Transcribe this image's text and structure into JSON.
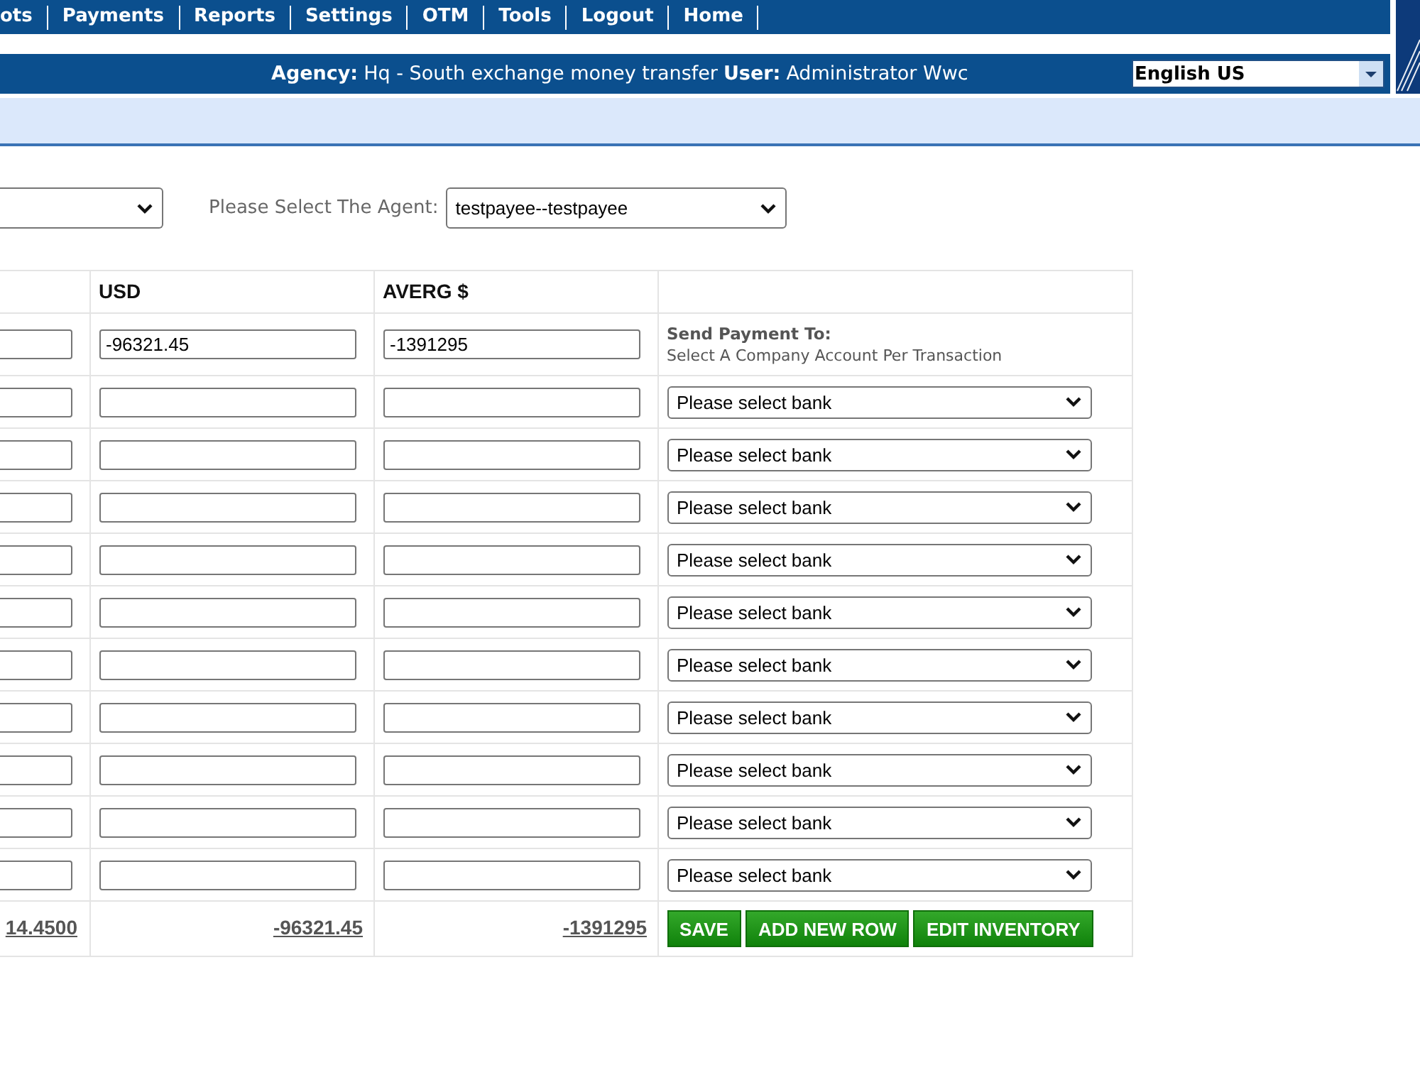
{
  "nav": {
    "items": [
      "ots",
      "Payments",
      "Reports",
      "Settings",
      "OTM",
      "Tools",
      "Logout",
      "Home"
    ]
  },
  "info_bar": {
    "agency": {
      "label": "Agency:",
      "value": "Hq - South exchange money transfer"
    },
    "user": {
      "label": "User:",
      "value": "Administrator Wwc"
    },
    "language": "English US"
  },
  "filters": [
    {
      "kind": "select"
    },
    {
      "kind": "labeled_select",
      "label": "Please Select The Agent:",
      "value": "testpayee--testpayee"
    }
  ],
  "table": {
    "columns": [
      null,
      "USD",
      "AVERG $",
      null
    ],
    "rows": [
      {
        "kind": "summary",
        "usd_value": "-96321.45",
        "averg_value": "-1391295",
        "send_to": {
          "title": "Send Payment To:",
          "hint": "Select A Company Account Per Transaction"
        }
      },
      {
        "kind": "entry",
        "bank": "Please select bank"
      },
      {
        "kind": "entry",
        "bank": "Please select bank"
      },
      {
        "kind": "entry",
        "bank": "Please select bank"
      },
      {
        "kind": "entry",
        "bank": "Please select bank"
      },
      {
        "kind": "entry",
        "bank": "Please select bank"
      },
      {
        "kind": "entry",
        "bank": "Please select bank"
      },
      {
        "kind": "entry",
        "bank": "Please select bank"
      },
      {
        "kind": "entry",
        "bank": "Please select bank"
      },
      {
        "kind": "entry",
        "bank": "Please select bank"
      },
      {
        "kind": "entry",
        "bank": "Please select bank"
      }
    ],
    "totals": [
      "14.4500",
      "-96321.45",
      "-1391295"
    ],
    "buttons": [
      "SAVE",
      "ADD NEW ROW",
      "EDIT INVENTORY"
    ]
  }
}
